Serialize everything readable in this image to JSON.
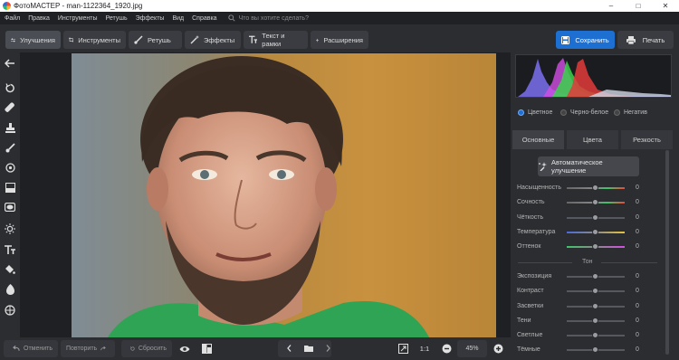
{
  "window": {
    "title": "ФотоМАСТЕР - man-1122364_1920.jpg",
    "minimize": "–",
    "maximize": "□",
    "close": "✕"
  },
  "menu": {
    "items": [
      "Файл",
      "Правка",
      "Инструменты",
      "Ретушь",
      "Эффекты",
      "Вид",
      "Справка"
    ],
    "search_placeholder": "Что вы хотите сделать?"
  },
  "toolbar": {
    "tabs": [
      {
        "label": "Улучшения",
        "icon": "sliders-icon"
      },
      {
        "label": "Инструменты",
        "icon": "crop-icon"
      },
      {
        "label": "Ретушь",
        "icon": "brush-icon"
      },
      {
        "label": "Эффекты",
        "icon": "magic-wand-icon"
      },
      {
        "label": "Текст и рамки",
        "icon": "text-icon"
      },
      {
        "label": "Расширения",
        "icon": "plus-icon"
      }
    ],
    "save_label": "Сохранить",
    "print_label": "Печать"
  },
  "bottom": {
    "undo_label": "Отменить",
    "redo_label": "Повторить",
    "reset_label": "Сбросить",
    "ratio_label": "1:1",
    "zoom": "45%"
  },
  "panel": {
    "modes": [
      "Цветное",
      "Черно-белое",
      "Негатив"
    ],
    "selected_mode": "Цветное",
    "tabs": [
      "Основные",
      "Цвета",
      "Резкость"
    ],
    "active_tab": "Основные",
    "auto_label": "Автоматическое улучшение",
    "sliders_main": [
      {
        "label": "Насыщенность",
        "value": "0"
      },
      {
        "label": "Сочность",
        "value": "0"
      },
      {
        "label": "Чёткость",
        "value": "0"
      },
      {
        "label": "Температура",
        "value": "0"
      },
      {
        "label": "Оттенок",
        "value": "0"
      }
    ],
    "section_tone": "Тон",
    "sliders_tone": [
      {
        "label": "Экспозиция",
        "value": "0"
      },
      {
        "label": "Контраст",
        "value": "0"
      },
      {
        "label": "Засветки",
        "value": "0"
      },
      {
        "label": "Тени",
        "value": "0"
      },
      {
        "label": "Светлые",
        "value": "0"
      },
      {
        "label": "Тёмные",
        "value": "0"
      }
    ]
  },
  "colors": {
    "accent": "#1d6fd1",
    "background": "#2b2d31",
    "canvas": "#1f2023"
  }
}
